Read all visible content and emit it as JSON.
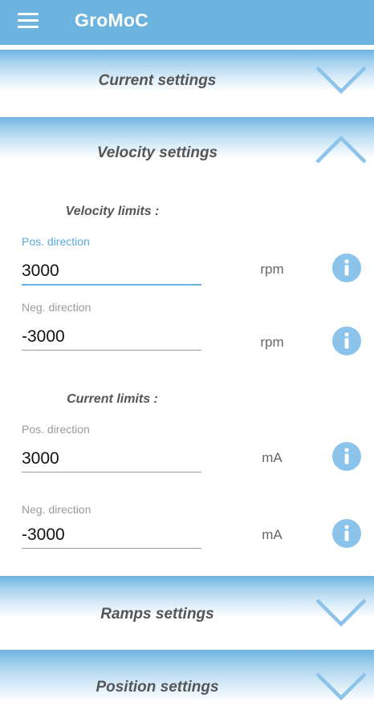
{
  "app": {
    "title": "GroMoC"
  },
  "sections": {
    "current": {
      "title": "Current settings",
      "state": "collapsed",
      "chevron_icon": "chevron-down-icon"
    },
    "velocity": {
      "title": "Velocity settings",
      "state": "expanded",
      "chevron_icon": "chevron-up-icon"
    },
    "ramps": {
      "title": "Ramps settings",
      "state": "collapsed",
      "chevron_icon": "chevron-down-icon"
    },
    "position": {
      "title": "Position settings",
      "state": "collapsed",
      "chevron_icon": "chevron-down-icon"
    }
  },
  "velocity_limits": {
    "heading": "Velocity limits :",
    "pos": {
      "label": "Pos. direction",
      "value": "3000",
      "unit": "rpm"
    },
    "neg": {
      "label": "Neg. direction",
      "value": "-3000",
      "unit": "rpm"
    }
  },
  "current_limits": {
    "heading": "Current limits :",
    "pos": {
      "label": "Pos. direction",
      "value": "3000",
      "unit": "mA"
    },
    "neg": {
      "label": "Neg. direction",
      "value": "-3000",
      "unit": "mA"
    }
  },
  "info_icon_glyph": "i",
  "colors": {
    "app_bar": "#6db3df",
    "accent": "#5aa9dd",
    "info_icon": "#8cc3ea",
    "section_title": "#555555"
  }
}
